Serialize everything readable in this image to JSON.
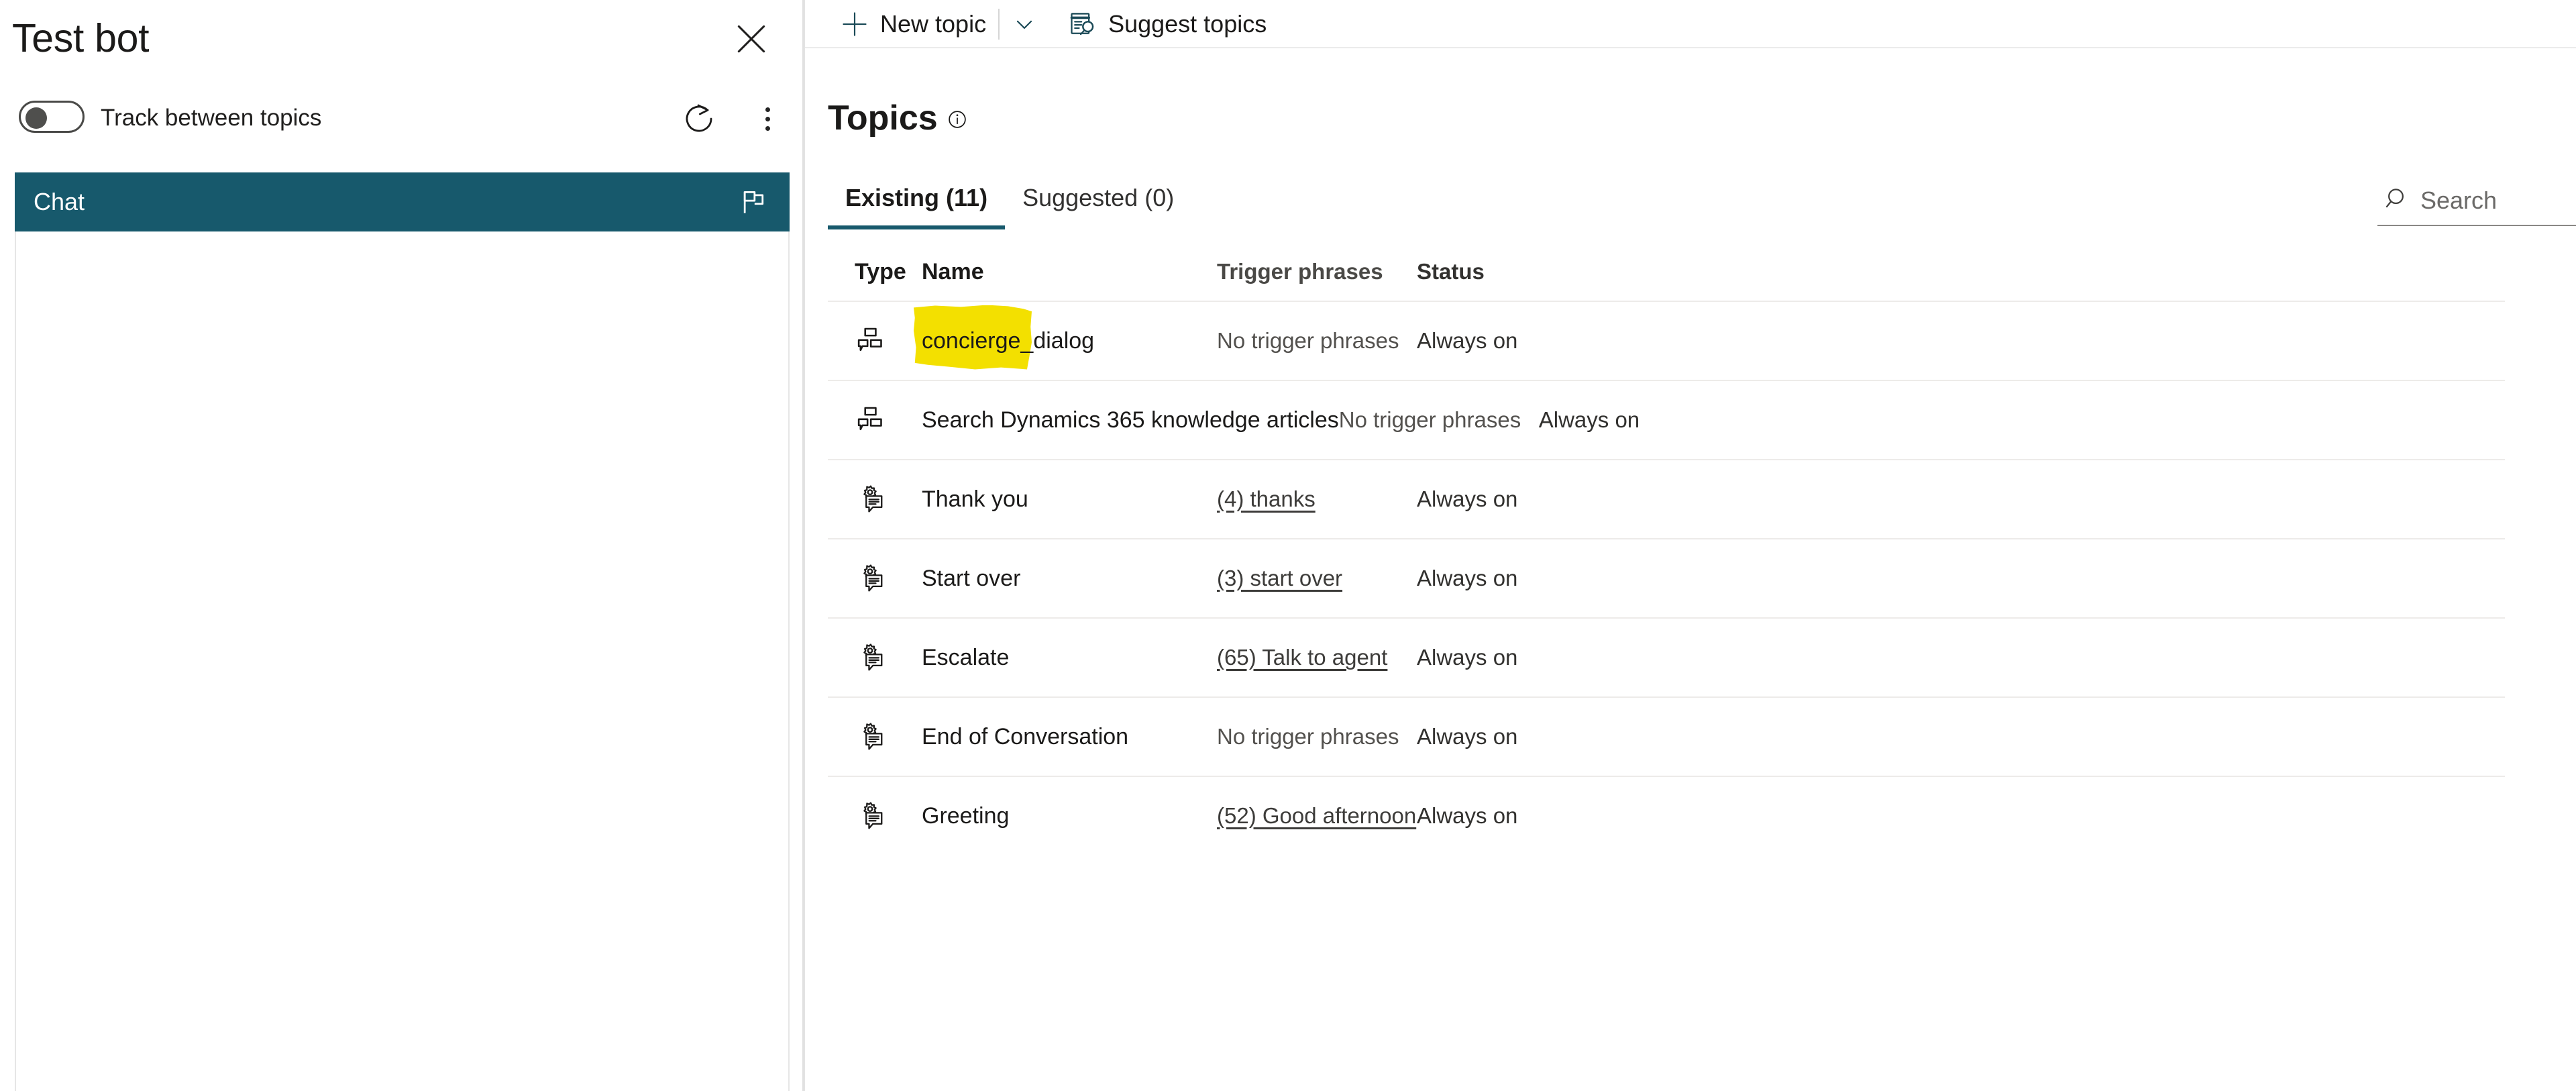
{
  "test_panel": {
    "title": "Test bot",
    "close_icon": "close-icon",
    "toggle": {
      "label": "Track between topics",
      "state": "off"
    },
    "refresh_icon": "refresh-icon",
    "more_icon": "more-vertical-icon",
    "chat_tab": {
      "label": "Chat",
      "flag_icon": "flag-icon"
    }
  },
  "command_bar": {
    "new_topic": {
      "label": "New topic",
      "icon": "plus-icon"
    },
    "new_topic_caret": "chevron-down-icon",
    "suggest_topics": {
      "label": "Suggest topics",
      "icon": "document-search-icon"
    }
  },
  "page": {
    "title": "Topics",
    "info_icon": "info-icon"
  },
  "tabs": [
    {
      "label": "Existing (11)",
      "active": true
    },
    {
      "label": "Suggested (0)",
      "active": false
    }
  ],
  "search": {
    "placeholder": "Search",
    "icon": "search-icon"
  },
  "table": {
    "columns": [
      "Type",
      "Name",
      "Trigger phrases",
      "Status"
    ],
    "rows": [
      {
        "type_icon": "dialog-topic-icon",
        "name": "concierge_dialog",
        "highlighted": true,
        "trigger_phrases": "No trigger phrases",
        "trigger_is_link": false,
        "status": "Always on"
      },
      {
        "type_icon": "dialog-topic-icon",
        "name": "Search Dynamics 365 knowledge articles",
        "highlighted": false,
        "trigger_phrases": "No trigger phrases",
        "trigger_is_link": false,
        "status": "Always on"
      },
      {
        "type_icon": "system-topic-icon",
        "name": "Thank you",
        "highlighted": false,
        "trigger_phrases": "(4) thanks",
        "trigger_is_link": true,
        "status": "Always on"
      },
      {
        "type_icon": "system-topic-icon",
        "name": "Start over",
        "highlighted": false,
        "trigger_phrases": "(3) start over",
        "trigger_is_link": true,
        "status": "Always on"
      },
      {
        "type_icon": "system-topic-icon",
        "name": "Escalate",
        "highlighted": false,
        "trigger_phrases": "(65) Talk to agent",
        "trigger_is_link": true,
        "status": "Always on"
      },
      {
        "type_icon": "system-topic-icon",
        "name": "End of Conversation",
        "highlighted": false,
        "trigger_phrases": "No trigger phrases",
        "trigger_is_link": false,
        "status": "Always on"
      },
      {
        "type_icon": "system-topic-icon",
        "name": "Greeting",
        "highlighted": false,
        "trigger_phrases": "(52) Good afternoon",
        "trigger_is_link": true,
        "status": "Always on"
      }
    ]
  },
  "colors": {
    "accent_teal": "#17596c",
    "highlight_yellow": "#f3e000",
    "text_primary": "#1b1a19",
    "row_divider": "#edebe9"
  }
}
